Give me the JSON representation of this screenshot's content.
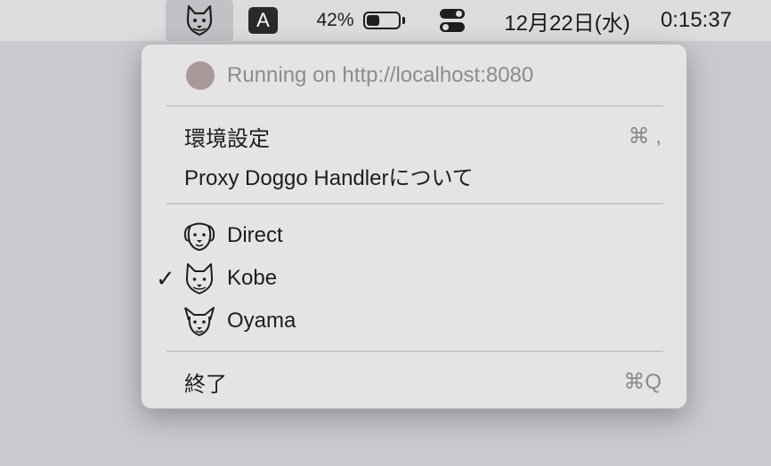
{
  "menubar": {
    "input_source": "A",
    "battery_percent": "42%",
    "battery_level": 0.42,
    "date": "12月22日(水)",
    "time": "0:15:37"
  },
  "menu": {
    "status": "Running on http://localhost:8080",
    "preferences": {
      "label": "環境設定",
      "shortcut": "⌘ ,"
    },
    "about": {
      "label": "Proxy Doggo Handlerについて"
    },
    "profiles": [
      {
        "label": "Direct",
        "icon": "retriever-dog-icon",
        "checked": false
      },
      {
        "label": "Kobe",
        "icon": "shiba-dog-icon",
        "checked": true,
        "check": "✓"
      },
      {
        "label": "Oyama",
        "icon": "corgi-dog-icon",
        "checked": false
      }
    ],
    "quit": {
      "label": "終了",
      "shortcut": "⌘Q"
    }
  }
}
